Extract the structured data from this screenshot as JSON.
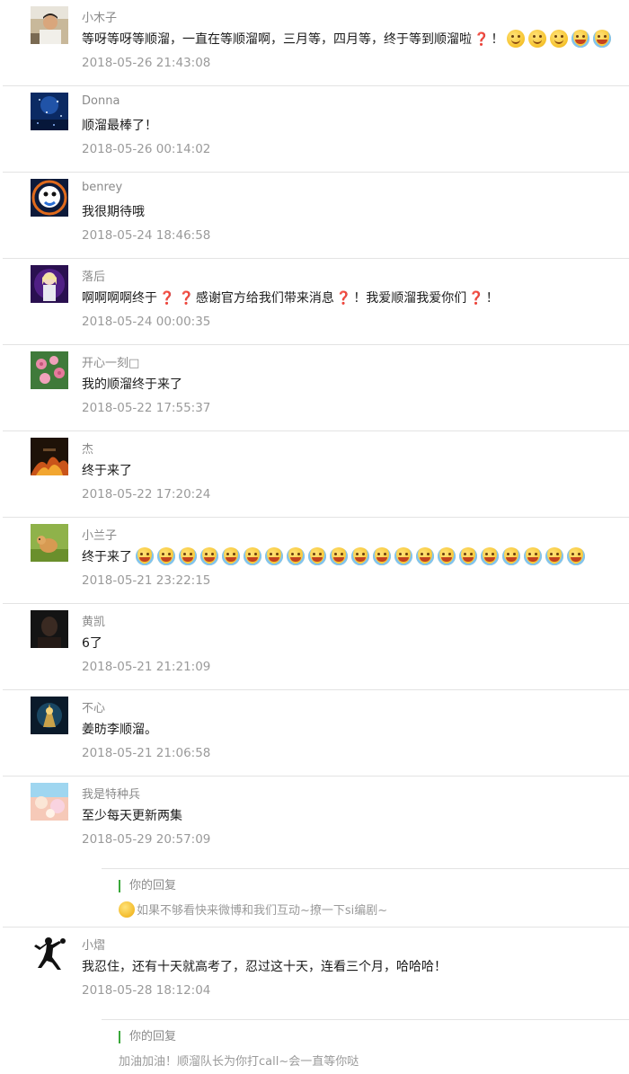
{
  "comments": [
    {
      "name": "小木子",
      "text": "等呀等呀等顺溜，一直在等顺溜啊，三月等，四月等，终于等到顺溜啦",
      "text_tail": "！",
      "time": "2018-05-26 21:43:08",
      "avatar": "man-photo-icon"
    },
    {
      "name": "Donna",
      "text": "顺溜最棒了！",
      "time": "2018-05-26 00:14:02",
      "avatar": "blue-stars-icon"
    },
    {
      "name": "benrey",
      "text": "我很期待哦",
      "time": "2018-05-24 18:46:58",
      "avatar": "cartoon-bird-icon"
    },
    {
      "name": "落后",
      "text_part1": "啊啊啊啊终于",
      "text_part2": "感谢官方给我们带来消息",
      "text_part3": "！我爱顺溜我爱你们",
      "text_part4": "！",
      "time": "2018-05-24 00:00:35",
      "avatar": "anime-girl-icon"
    },
    {
      "name": "开心一刻□",
      "text": "我的顺溜终于来了",
      "time": "2018-05-22 17:55:37",
      "avatar": "pink-roses-icon"
    },
    {
      "name": "杰",
      "text": "终于来了",
      "time": "2018-05-22 17:20:24",
      "avatar": "fire-scene-icon"
    },
    {
      "name": "小兰子",
      "text": "终于来了",
      "time": "2018-05-21 23:22:15",
      "avatar": "puppy-photo-icon"
    },
    {
      "name": "黄凯",
      "text": "6了",
      "time": "2018-05-21 21:21:09",
      "avatar": "dark-portrait-icon"
    },
    {
      "name": "不心",
      "text": "姜昉李顺溜。",
      "time": "2018-05-21 21:06:58",
      "avatar": "game-character-icon"
    },
    {
      "name": "我是特种兵",
      "text": "至少每天更新两集",
      "time": "2018-05-29 20:57:09",
      "avatar": "pastel-sky-icon",
      "reply": {
        "label": "你的回复",
        "text": "如果不够看快来微博和我们互动~撩一下si编剧~"
      }
    },
    {
      "name": "小熠",
      "text": "我忍住，还有十天就高考了，忍过这十天，连看三个月，哈哈哈！",
      "time": "2018-05-28 18:12:04",
      "avatar": "pingpong-silhouette-icon",
      "reply": {
        "label": "你的回复",
        "text": "加油加油！顺溜队长为你打call~会一直等你哒"
      }
    }
  ],
  "emoji": {
    "smile_icon": "smile-emoji-icon",
    "laugh_cry_icon": "laugh-cry-emoji-icon",
    "question_icon": "red-question-mark-icon",
    "think_icon": "thinking-emoji-icon",
    "question_char": "❓"
  }
}
